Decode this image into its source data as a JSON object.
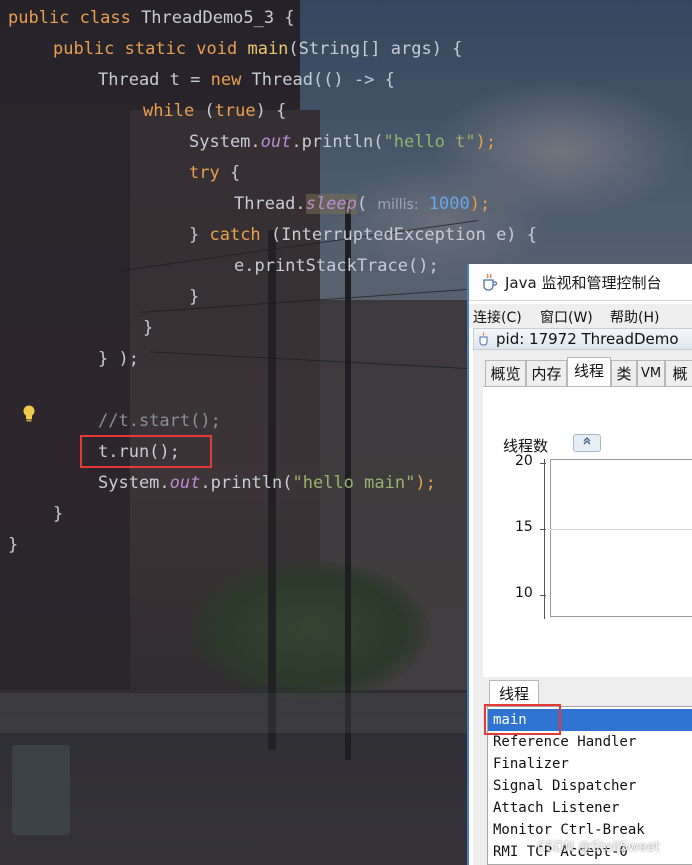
{
  "editor": {
    "lines": [
      {
        "t1": "public class ",
        "t2": "ThreadDemo5_3 {"
      },
      {
        "t1": "public static void ",
        "t2": "main",
        "t3": "(String[] args) {"
      },
      {
        "t1": "Thread t = ",
        "t2": "new ",
        "t3": "Thread(() -> {"
      },
      {
        "t1": "while ",
        "t2": "(",
        "t3": "true",
        "t4": ") {"
      },
      {
        "t1": "System.",
        "t2": "out",
        "t3": ".println(",
        "t4": "\"hello t\"",
        "t5": ");"
      },
      {
        "t1": "try ",
        "t2": "{"
      },
      {
        "t1": "Thread.",
        "t2": "sleep",
        "t3": "( ",
        "hint": "millis:",
        "t4": " 1000",
        "t5": ");"
      },
      {
        "t1": "} ",
        "t2": "catch ",
        "t3": "(InterruptedException e) {"
      },
      {
        "t1": "e.printStackTrace();"
      },
      {
        "t1": "}"
      },
      {
        "t1": "}"
      },
      {
        "t1": "} );"
      },
      {
        "t1": "//t.start();"
      },
      {
        "t1": "t.run();"
      },
      {
        "t1": "System.",
        "t2": "out",
        "t3": ".println(",
        "t4": "\"hello main\"",
        "t5": ");"
      },
      {
        "t1": "}"
      },
      {
        "t1": "}"
      }
    ]
  },
  "jconsole": {
    "window_title": "Java 监视和管理控制台",
    "menu": [
      "连接(C)",
      "窗口(W)",
      "帮助(H)"
    ],
    "connection_title": "pid: 17972 ThreadDemo",
    "tabs": [
      "概览",
      "内存",
      "线程",
      "类",
      "VM",
      "概"
    ],
    "active_tab": "线程",
    "chart_label": "线程数",
    "threads_section_label": "线程",
    "threads": [
      "main",
      "Reference Handler",
      "Finalizer",
      "Signal Dispatcher",
      "Attach Listener",
      "Monitor Ctrl-Break",
      "RMI TCP Accept-0"
    ],
    "selected_thread": "main"
  },
  "chart_data": {
    "type": "line",
    "title": "",
    "ylabel": "线程数",
    "yticks": [
      20,
      15,
      10
    ],
    "ylim": [
      10,
      20
    ],
    "series": []
  },
  "watermark": "CSDN @StoilSweet",
  "colors": {
    "keyword": "#e8a04e",
    "function": "#f0c66a",
    "string": "#9ab16a",
    "static_field": "#b98cd4",
    "number": "#6aa7e8",
    "highlight_box": "#e53935",
    "selection": "#2f74d0"
  }
}
